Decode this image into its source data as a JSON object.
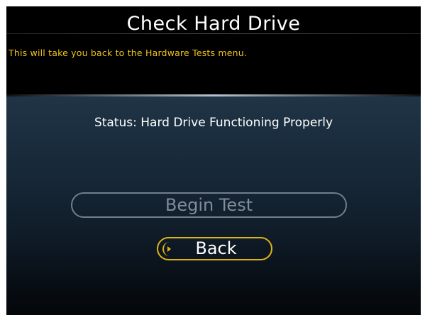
{
  "header": {
    "title": "Check Hard Drive",
    "help_text": "This will take you back to the Hardware Tests menu."
  },
  "main": {
    "status": "Status: Hard Drive Functioning Properly",
    "buttons": {
      "begin_test": "Begin Test",
      "back": "Back"
    }
  },
  "icons": {
    "back": "chevron-right-icon"
  },
  "colors": {
    "accent": "#f0c419",
    "title": "#ffffff",
    "disabled": "#7f8c99",
    "background_top": "#000000",
    "panel": "#1f3446"
  }
}
